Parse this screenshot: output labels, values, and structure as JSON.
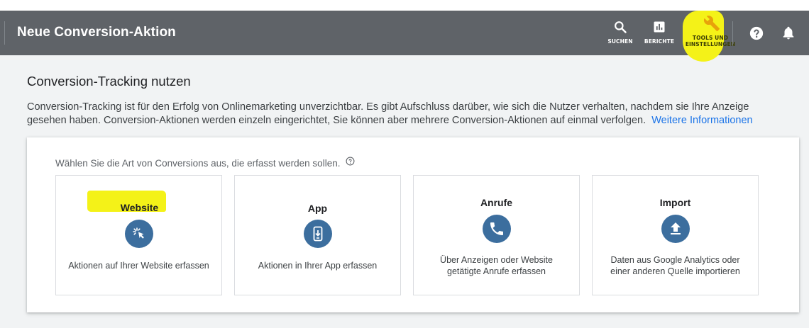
{
  "header": {
    "title": "Neue Conversion-Aktion",
    "search_label": "SUCHEN",
    "reports_label": "BERICHTE",
    "tools_label_line1": "TOOLS UND",
    "tools_label_line2": "EINSTELLUNGEN",
    "help_icon": "help-icon",
    "notifications_icon": "bell-icon",
    "highlight_color": "#f4f218",
    "bar_color": "#5f6368"
  },
  "intro": {
    "title": "Conversion-Tracking nutzen",
    "description": "Conversion-Tracking ist für den Erfolg von Onlinemarketing unverzichtbar. Es gibt Aufschluss darüber, wie sich die Nutzer verhalten, nachdem sie Ihre Anzeige gesehen haben. Conversion-Aktionen werden einzeln eingerichtet, Sie können aber mehrere Conversion-Aktionen auf einmal verfolgen.",
    "link": "Weitere Informationen",
    "link_color": "#1a73e8"
  },
  "chooser": {
    "prompt": "Wählen Sie die Art von Conversions aus, die erfasst werden sollen.",
    "icon_color": "#3c6e9e",
    "options": [
      {
        "title": "Website",
        "icon": "cursor-click-icon",
        "text": "Aktionen auf Ihrer Website erfassen"
      },
      {
        "title": "App",
        "icon": "phone-download-icon",
        "text": "Aktionen in Ihrer App erfassen"
      },
      {
        "title": "Anrufe",
        "icon": "phone-call-icon",
        "text": "Über Anzeigen oder Website getätigte Anrufe erfassen"
      },
      {
        "title": "Import",
        "icon": "upload-icon",
        "text": "Daten aus Google Analytics oder einer anderen Quelle importieren"
      }
    ]
  }
}
